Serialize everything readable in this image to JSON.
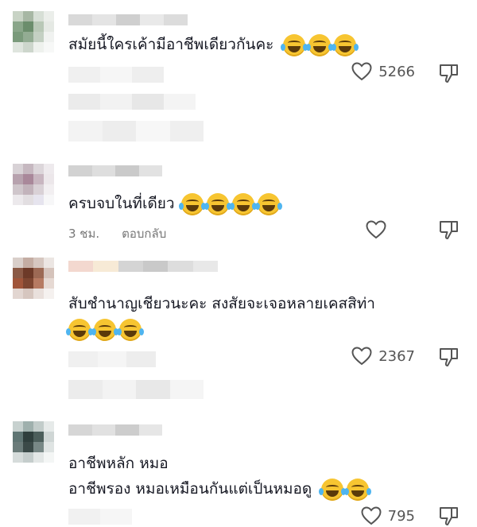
{
  "comments": [
    {
      "text": "สมัยนี้ใครเค้ามีอาชีพเดียวกันคะ",
      "emoji_count": 3,
      "likes": "5266"
    },
    {
      "text": "ครบจบในที่เดียว",
      "emoji_count": 4,
      "time": "3 ชม.",
      "reply_label": "ตอบกลับ"
    },
    {
      "text": "สับชำนาญเชียวนะคะ สงสัยจะเจอหลายเคสสิท่า",
      "emoji_count": 3,
      "likes": "2367"
    },
    {
      "line1": "อาชีพหลัก หมอ",
      "line2": "อาชีพรอง หมอเหมือนกันแต่เป็นหมอดู",
      "emoji_count": 2,
      "likes": "795"
    }
  ],
  "icons": {
    "like": "heart-outline-icon",
    "dislike": "thumbs-down-outline-icon",
    "reaction_emoji": "face-with-tears-of-joy"
  },
  "colors": {
    "text": "#161823",
    "meta": "#777777",
    "emoji": "#f7c531",
    "tear": "#4fb5f0"
  }
}
